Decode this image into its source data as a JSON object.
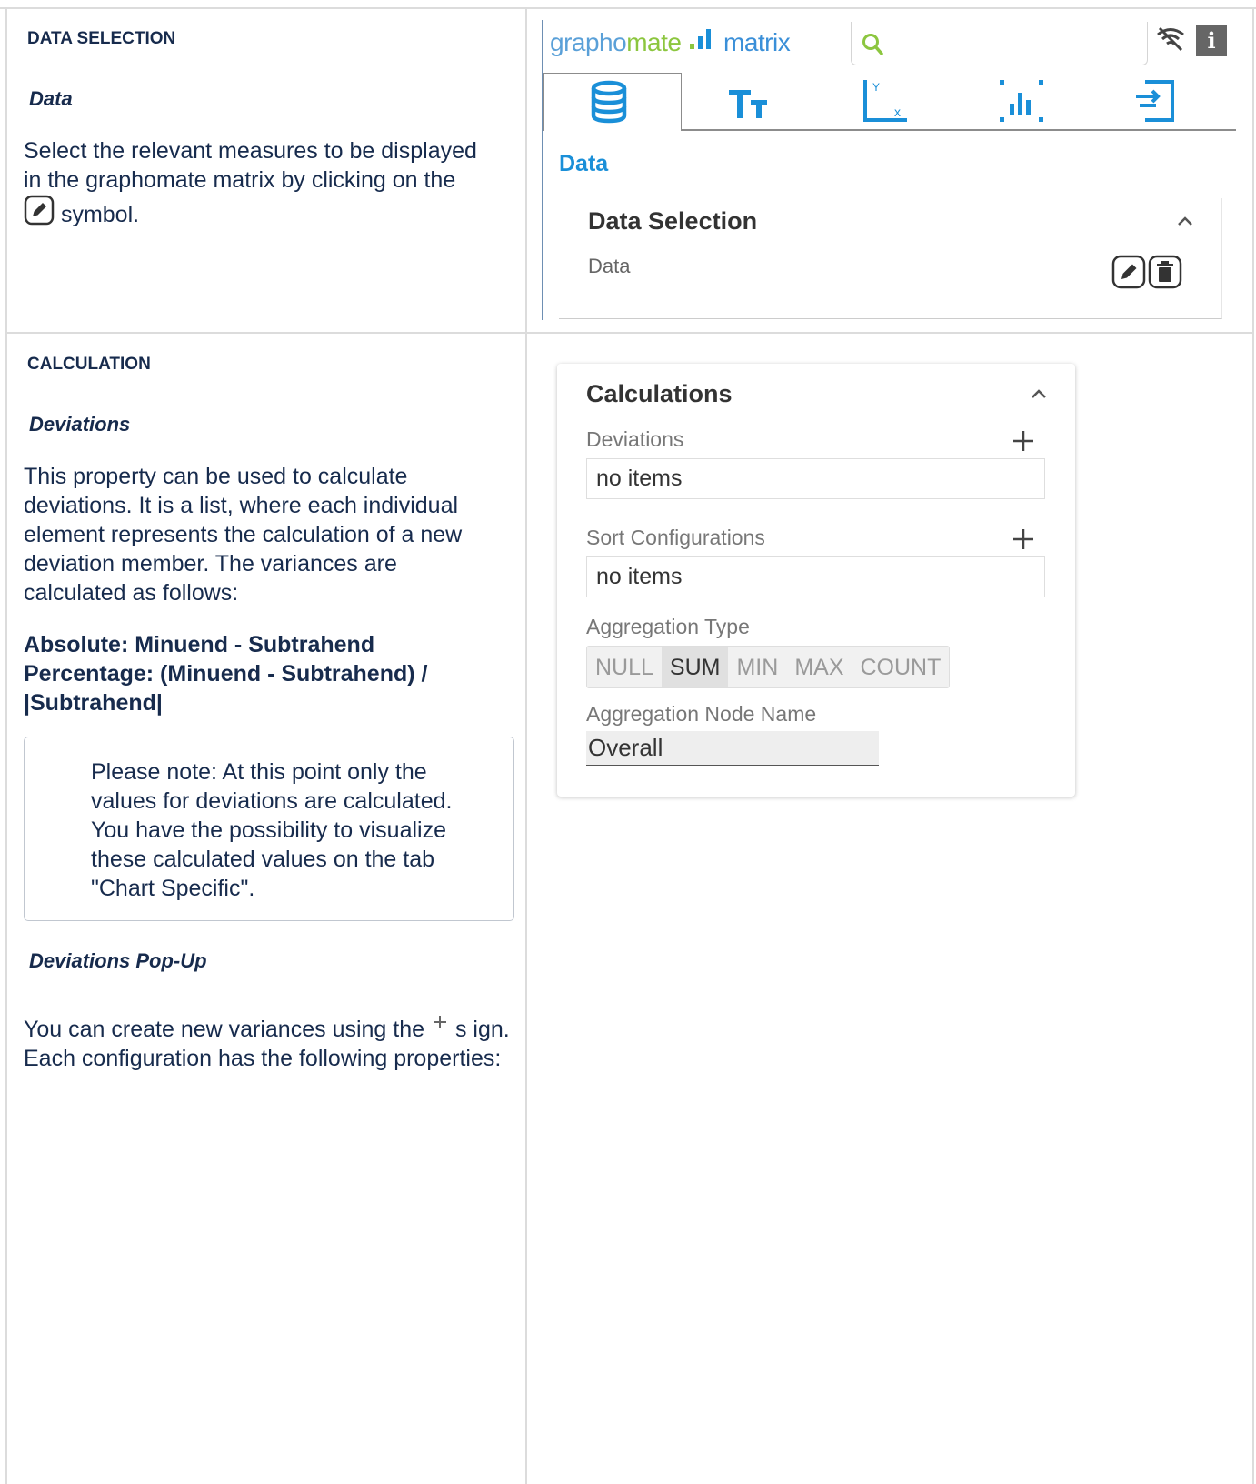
{
  "left": {
    "data_selection": {
      "heading": "DATA SELECTION",
      "subheading": "Data",
      "text_before_icon": "Select the relevant measures to be displayed in the graphomate matrix by clicking on the",
      "text_after_icon": "symbol."
    },
    "calculation": {
      "heading": "CALCULATION",
      "subheading": "Deviations",
      "paragraph": "This property can be used to calculate deviations. It is a list, where each individual element represents the calculation of a new deviation member. The variances are calculated as follows:",
      "formula_absolute": "Absolute: Minuend - Subtrahend",
      "formula_percentage": "Percentage: (Minuend - Subtrahend) / |Subtrahend|",
      "note": "Please note: At this point only the values for deviations are calculated. You have the possibility to visualize these calculated values on the tab \"Chart Specific\".",
      "popup_heading": "Deviations Pop-Up",
      "popup_text_before_icon": "You can create new variances using the",
      "popup_text_after_icon": "s ign. Each configuration has the following properties:"
    }
  },
  "panel": {
    "logo": {
      "part1": "grapho",
      "part2": "mate",
      "part3": "matrix"
    },
    "search": {
      "value": ""
    },
    "info_label": "i",
    "tabs": [
      {
        "icon": "database-icon",
        "active": true
      },
      {
        "icon": "text-size-icon",
        "active": false
      },
      {
        "icon": "axis-icon",
        "active": false
      },
      {
        "icon": "chart-bars-icon",
        "active": false
      },
      {
        "icon": "export-icon",
        "active": false
      }
    ],
    "section_heading": "Data",
    "data_selection_card": {
      "title": "Data Selection",
      "row_label": "Data"
    },
    "calculations_card": {
      "title": "Calculations",
      "deviations_label": "Deviations",
      "deviations_value": "no items",
      "sort_label": "Sort Configurations",
      "sort_value": "no items",
      "aggregation_type_label": "Aggregation Type",
      "aggregation_types": [
        "NULL",
        "SUM",
        "MIN",
        "MAX",
        "COUNT"
      ],
      "aggregation_selected": "SUM",
      "aggregation_node_label": "Aggregation Node Name",
      "aggregation_node_value": "Overall"
    }
  },
  "colors": {
    "accent_blue": "#1a8fd8",
    "logo_green": "#8cc63f",
    "text": "#172b4d"
  }
}
